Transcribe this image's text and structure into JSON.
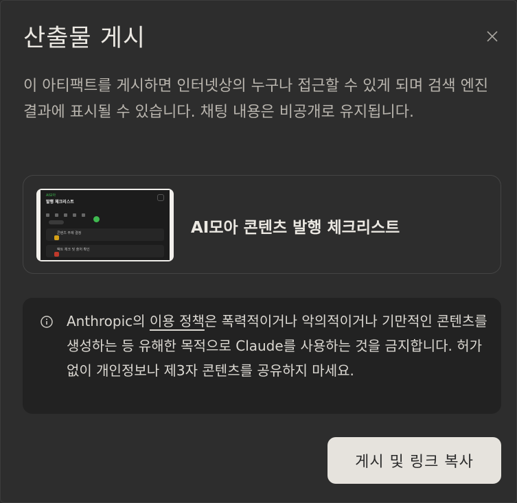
{
  "dialog": {
    "title": "산출물 게시",
    "description": "이 아티팩트를 게시하면 인터넷상의 누구나 접근할 수 있게 되며 검색 엔진 결과에 표시될 수 있습니다. 채팅 내용은 비공개로 유지됩니다.",
    "close_icon": "close-icon"
  },
  "artifact": {
    "title": "AI모아 콘텐츠 발행 체크리스트",
    "thumbnail": {
      "tag": "AI모아",
      "heading": "발행 체크리스트",
      "row1": "콘텐츠 주제 결정",
      "row2": "팩트 체크 및 출처 확인"
    }
  },
  "notice": {
    "icon": "info-icon",
    "prefix": "Anthropic의 ",
    "link": "이용 정책",
    "suffix": "은 폭력적이거나 악의적이거나 기만적인 콘텐츠를 생성하는 등 유해한 목적으로 Claude를 사용하는 것을 금지합니다. 허가 없이 개인정보나 제3자 콘텐츠를 공유하지 마세요."
  },
  "actions": {
    "publish_label": "게시 및 링크 복사"
  },
  "colors": {
    "background": "#2d2d2d",
    "notice_bg": "#222222",
    "button_bg": "#e6e3dd",
    "accent_green": "#3fb950"
  }
}
